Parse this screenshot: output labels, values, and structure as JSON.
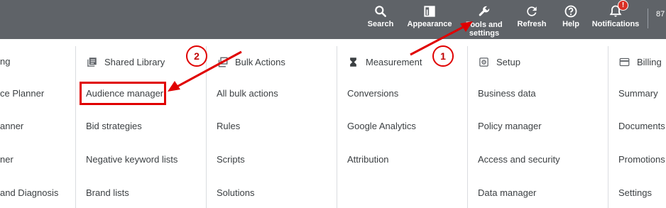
{
  "topbar": {
    "items": [
      {
        "label": "Search",
        "icon": "search-icon"
      },
      {
        "label": "Appearance",
        "icon": "appearance-icon"
      },
      {
        "label": "Tools and settings",
        "icon": "wrench-icon"
      },
      {
        "label": "Refresh",
        "icon": "refresh-icon"
      },
      {
        "label": "Help",
        "icon": "help-icon"
      },
      {
        "label": "Notifications",
        "icon": "bell-icon"
      }
    ],
    "notification_badge": "!",
    "account_fragment": "87"
  },
  "columns": [
    {
      "heading": "ng",
      "links": [
        "ce Planner",
        "anner",
        "ner",
        "and Diagnosis"
      ]
    },
    {
      "heading": "Shared Library",
      "icon": "library-icon",
      "links": [
        "Audience manager",
        "Bid strategies",
        "Negative keyword lists",
        "Brand lists"
      ]
    },
    {
      "heading": "Bulk Actions",
      "icon": "copy-icon",
      "links": [
        "All bulk actions",
        "Rules",
        "Scripts",
        "Solutions"
      ]
    },
    {
      "heading": "Measurement",
      "icon": "hourglass-icon",
      "links": [
        "Conversions",
        "Google Analytics",
        "Attribution"
      ]
    },
    {
      "heading": "Setup",
      "icon": "settings-icon",
      "links": [
        "Business data",
        "Policy manager",
        "Access and security",
        "Data manager"
      ]
    },
    {
      "heading": "Billing",
      "icon": "card-icon",
      "links": [
        "Summary",
        "Documents",
        "Promotions",
        "Settings"
      ]
    }
  ],
  "annotations": {
    "step1": "1",
    "step2": "2",
    "color": "#e00000"
  },
  "colors": {
    "topbar_bg": "#5f6368",
    "text": "#3c4043",
    "divider": "#dadce0"
  }
}
